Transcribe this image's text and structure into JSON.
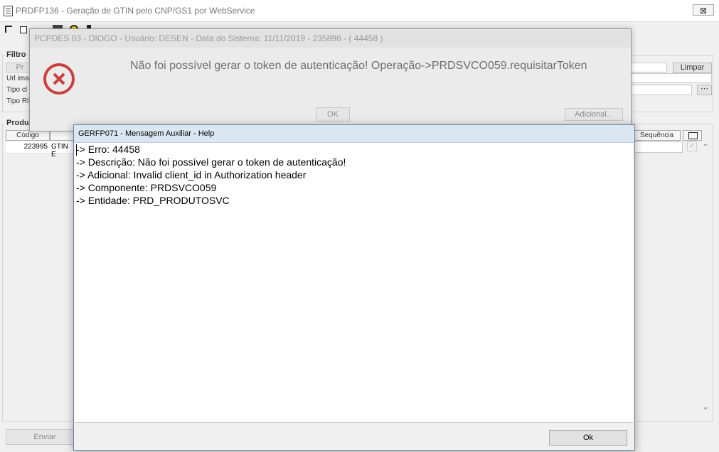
{
  "main_window": {
    "title": "PRDFP136 - Geração de GTIN pelo CNP/GS1 por WebService",
    "close_glyph": "⊠"
  },
  "filtro": {
    "label": "Filtro",
    "truncated_button": "Pr",
    "url_label": "Url ima",
    "tipo_label_1": "Tipo cl",
    "tipo_label_2": "Tipo Rl",
    "limpar_label": "Limpar"
  },
  "produtos": {
    "label": "Produ",
    "col_codigo": "Código",
    "col_sequencia": "Sequência",
    "row_codigo": "223995",
    "row_desc": "GTIN E"
  },
  "enviar_label": "Enviar",
  "error_dialog": {
    "title": "PCPDES 03 - DIOGO - Usuário: DESEN - Data do Sistema: 11/11/2019 - 235898 - ( 44458 )",
    "message": "Não foi possível gerar o token de autenticação! Operação->PRDSVCO059.requisitarToken",
    "ok_label": "OK",
    "adicional_label": "Adicional...",
    "error_color": "#c9403e"
  },
  "help_dialog": {
    "title": "GERFP071 - Mensagem Auxiliar - Help",
    "lines": [
      "-> Erro: 44458",
      "-> Descrição: Não foi possível gerar o token de autenticação!",
      "-> Adicional: Invalid client_id in Authorization header",
      "-> Componente: PRDSVCO059",
      "-> Entidade: PRD_PRODUTOSVC"
    ],
    "ok_label": "Ok"
  },
  "scroll_up_glyph": "⌃",
  "scroll_down_glyph": "⌄",
  "check_glyph": "✓",
  "ellipsis_glyph": "⋯"
}
